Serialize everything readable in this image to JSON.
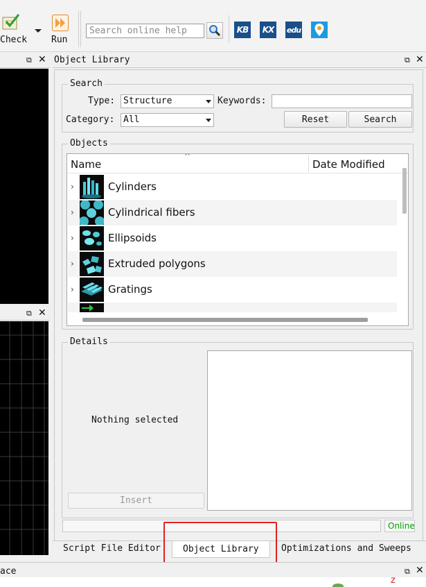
{
  "toolbar": {
    "check_label": "Check",
    "run_label": "Run",
    "search_placeholder": "Search online help",
    "links": [
      {
        "text": "KB",
        "color": "#1a4f8a"
      },
      {
        "text": "KX",
        "color": "#1a4f8a"
      },
      {
        "text": "edu",
        "color": "#1a4f8a"
      }
    ]
  },
  "object_library": {
    "title": "Object Library",
    "search_group": {
      "title": "Search",
      "type_label": "Type:",
      "type_value": "Structure",
      "keywords_label": "Keywords:",
      "keywords_value": "",
      "category_label": "Category:",
      "category_value": "All",
      "reset_label": "Reset",
      "search_label": "Search"
    },
    "objects_group": {
      "title": "Objects",
      "sort_indicator": "^",
      "columns": [
        "Name",
        "Date Modified"
      ],
      "items": [
        {
          "name": "Cylinders",
          "icon": "cylinders-icon"
        },
        {
          "name": "Cylindrical fibers",
          "icon": "cylindrical-fibers-icon"
        },
        {
          "name": "Ellipsoids",
          "icon": "ellipsoids-icon"
        },
        {
          "name": "Extruded polygons",
          "icon": "extruded-polygons-icon"
        },
        {
          "name": "Gratings",
          "icon": "gratings-icon"
        }
      ]
    },
    "details_group": {
      "title": "Details",
      "empty_text": "Nothing selected",
      "insert_label": "Insert"
    },
    "status": "Online",
    "status_color": "#00a000"
  },
  "tabs": [
    {
      "label": "Script File Editor"
    },
    {
      "label": "Object Library",
      "active": true
    },
    {
      "label": "Optimizations and Sweeps"
    }
  ],
  "bottom_panel": {
    "title_fragment": "ace"
  },
  "highlight_color": "#e02020"
}
